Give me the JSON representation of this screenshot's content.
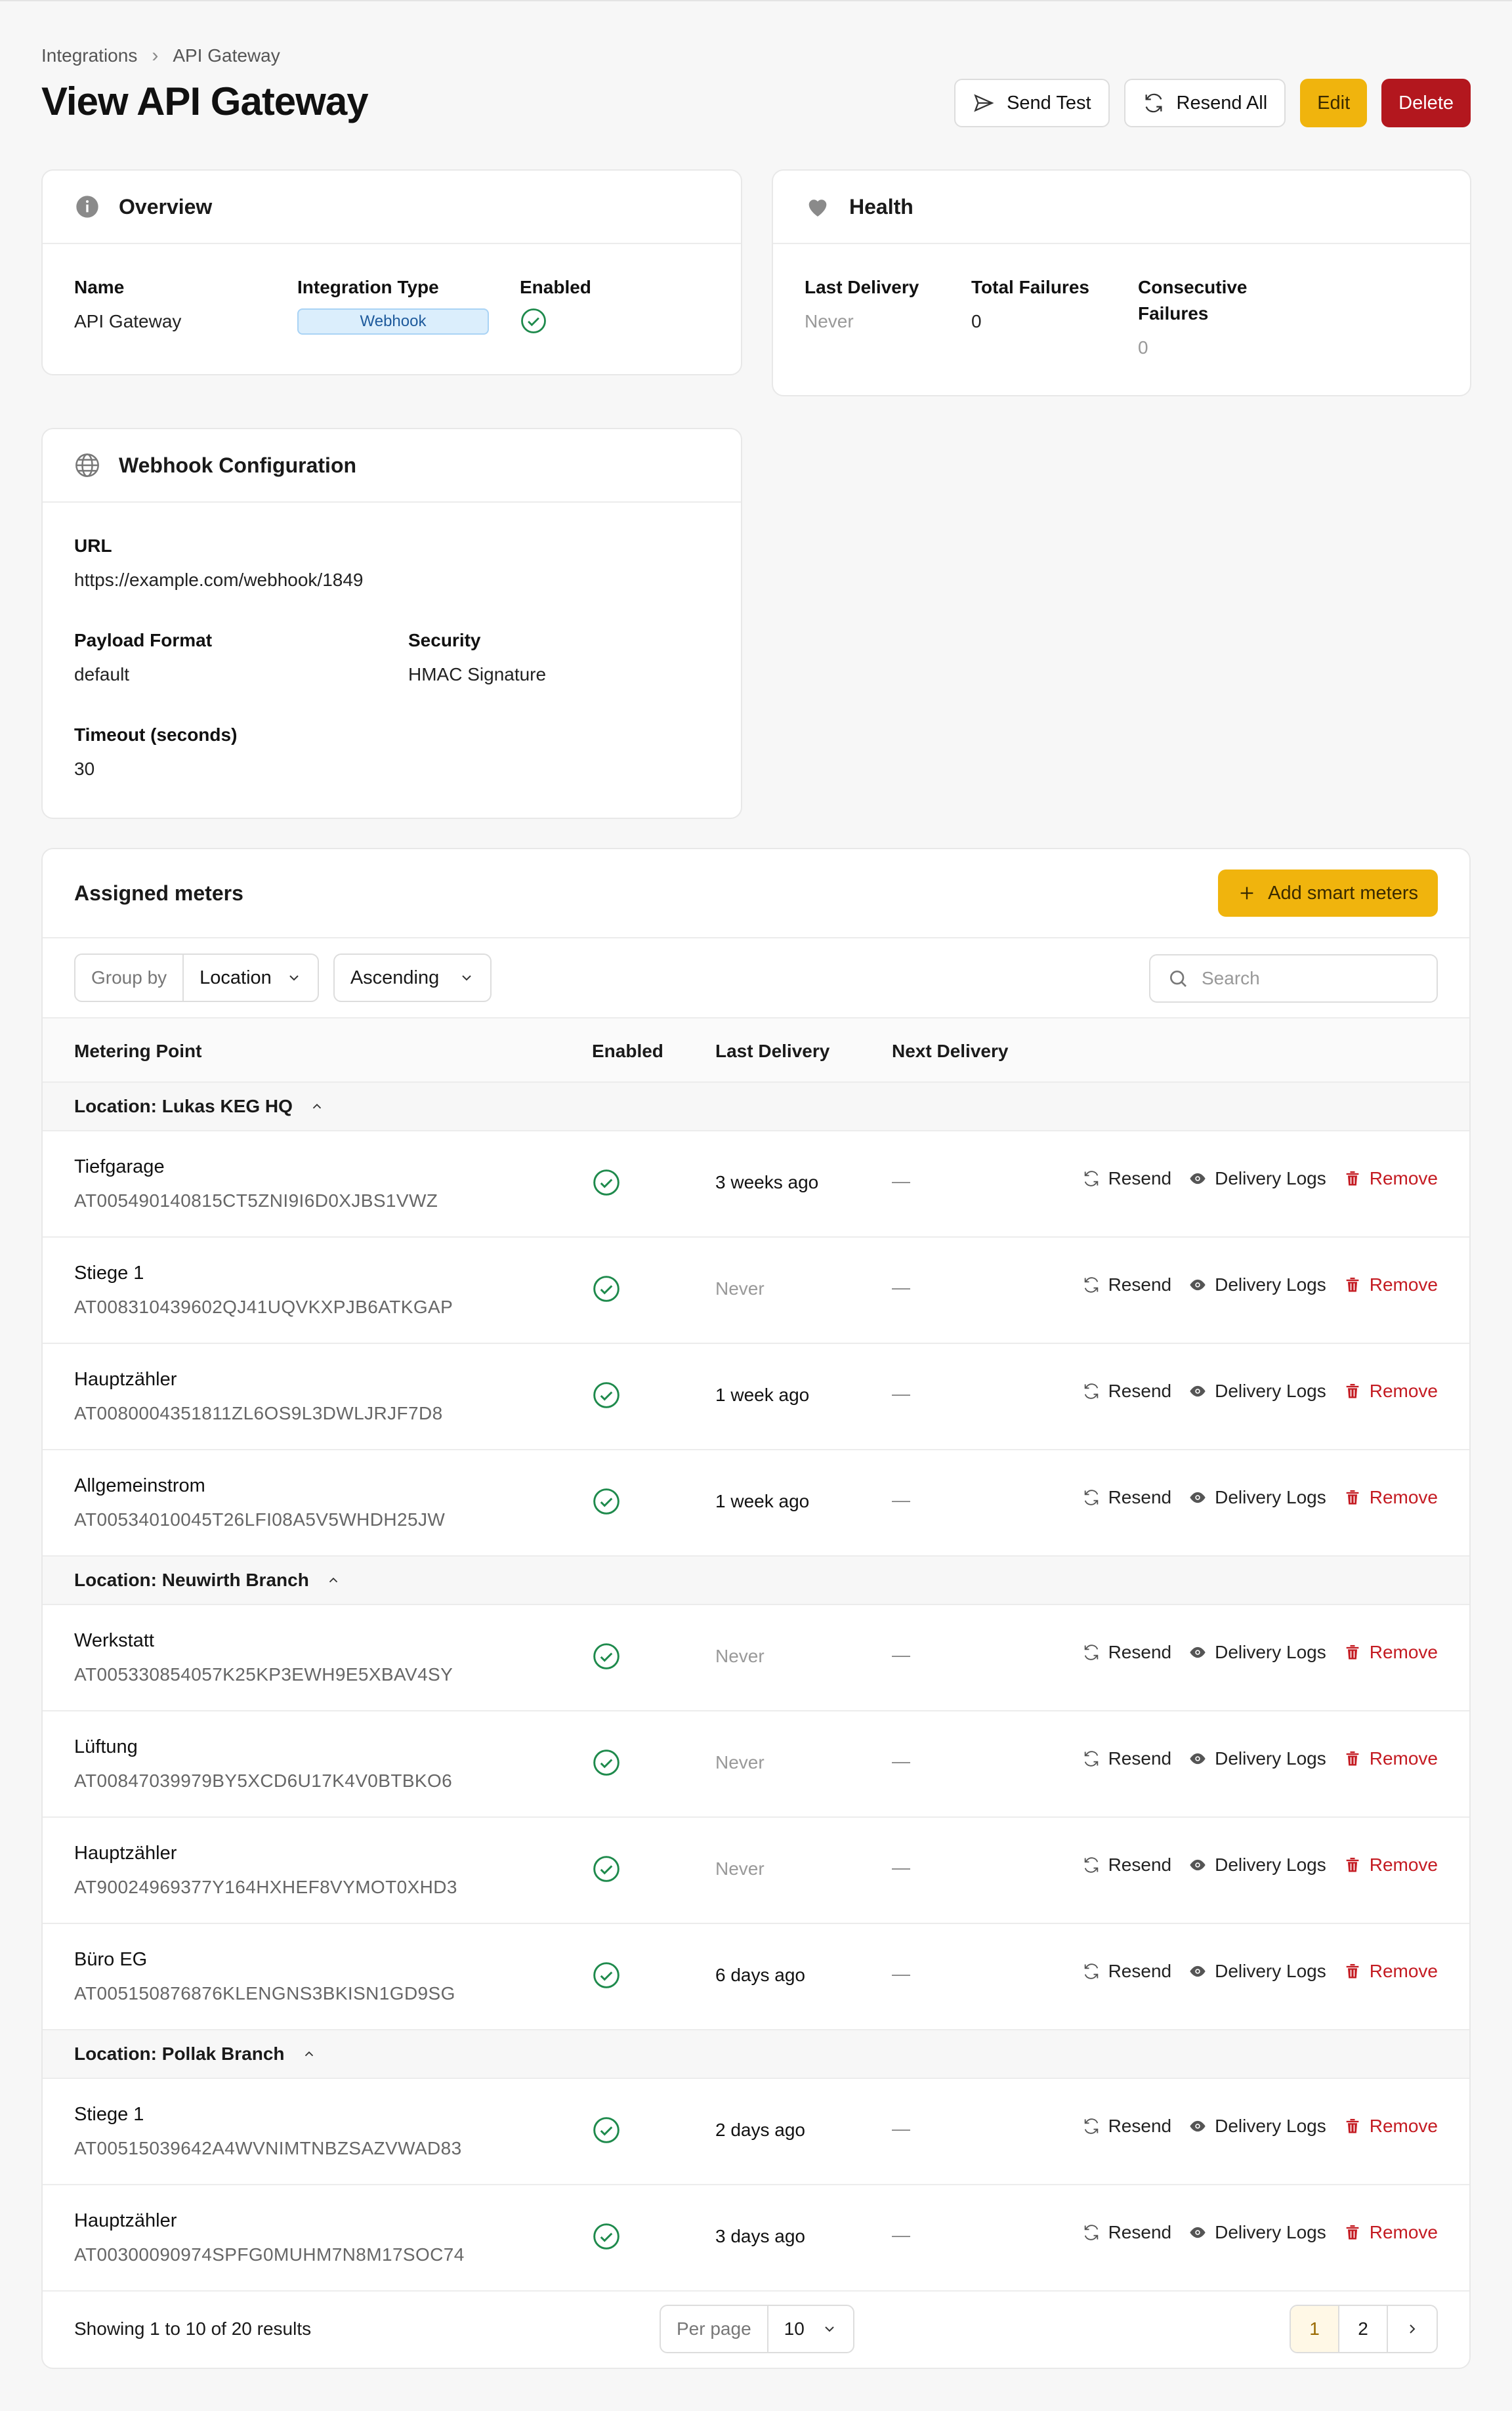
{
  "breadcrumb": {
    "parent": "Integrations",
    "current": "API Gateway"
  },
  "title": "View API Gateway",
  "actions": {
    "send_test": "Send Test",
    "resend_all": "Resend All",
    "edit": "Edit",
    "delete": "Delete"
  },
  "overview": {
    "title": "Overview",
    "name_label": "Name",
    "name": "API Gateway",
    "type_label": "Integration Type",
    "type": "Webhook",
    "enabled_label": "Enabled"
  },
  "health": {
    "title": "Health",
    "last_delivery_label": "Last Delivery",
    "last_delivery": "Never",
    "total_failures_label": "Total Failures",
    "total_failures": "0",
    "consecutive_label_1": "Consecutive",
    "consecutive_label_2": "Failures",
    "consecutive": "0"
  },
  "webhook": {
    "title": "Webhook Configuration",
    "url_label": "URL",
    "url": "https://example.com/webhook/1849",
    "payload_label": "Payload Format",
    "payload": "default",
    "security_label": "Security",
    "security": "HMAC Signature",
    "timeout_label": "Timeout (seconds)",
    "timeout": "30"
  },
  "meters": {
    "title": "Assigned meters",
    "add_label": "Add smart meters",
    "group_by_label": "Group by",
    "group_by": "Location",
    "order": "Ascending",
    "search_placeholder": "Search",
    "columns": [
      "Metering Point",
      "Enabled",
      "Last Delivery",
      "Next Delivery"
    ],
    "row_actions": {
      "resend": "Resend",
      "logs": "Delivery Logs",
      "remove": "Remove"
    },
    "groups": [
      {
        "label": "Location: Lukas KEG HQ",
        "rows": [
          {
            "name": "Tiefgarage",
            "code": "AT005490140815CT5ZNI9I6D0XJBS1VWZ",
            "last": "3 weeks ago",
            "next": "—"
          },
          {
            "name": "Stiege 1",
            "code": "AT008310439602QJ41UQVKXPJB6ATKGAP",
            "last": "Never",
            "next": "—"
          },
          {
            "name": "Hauptzähler",
            "code": "AT0080004351811ZL6OS9L3DWLJRJF7D8",
            "last": "1 week ago",
            "next": "—"
          },
          {
            "name": "Allgemeinstrom",
            "code": "AT00534010045T26LFI08A5V5WHDH25JW",
            "last": "1 week ago",
            "next": "—"
          }
        ]
      },
      {
        "label": "Location: Neuwirth Branch",
        "rows": [
          {
            "name": "Werkstatt",
            "code": "AT005330854057K25KP3EWH9E5XBAV4SY",
            "last": "Never",
            "next": "—"
          },
          {
            "name": "Lüftung",
            "code": "AT00847039979BY5XCD6U17K4V0BTBKO6",
            "last": "Never",
            "next": "—"
          },
          {
            "name": "Hauptzähler",
            "code": "AT90024969377Y164HXHEF8VYMOT0XHD3",
            "last": "Never",
            "next": "—"
          },
          {
            "name": "Büro EG",
            "code": "AT005150876876KLENGNS3BKISN1GD9SG",
            "last": "6 days ago",
            "next": "—"
          }
        ]
      },
      {
        "label": "Location: Pollak Branch",
        "rows": [
          {
            "name": "Stiege 1",
            "code": "AT00515039642A4WVNIMTNBZSAZVWAD83",
            "last": "2 days ago",
            "next": "—"
          },
          {
            "name": "Hauptzähler",
            "code": "AT00300090974SPFG0MUHM7N8M17SOC74",
            "last": "3 days ago",
            "next": "—"
          }
        ]
      }
    ],
    "pagination": {
      "summary": "Showing 1 to 10 of 20 results",
      "per_page_label": "Per page",
      "per_page": "10",
      "pages": [
        "1",
        "2"
      ],
      "current": "1",
      "next_icon": "chevron-right-icon"
    }
  },
  "colors": {
    "accent": "#f0b40d",
    "danger": "#b3171e",
    "success": "#1e8a4c",
    "badge_bg": "#dbeefc"
  }
}
